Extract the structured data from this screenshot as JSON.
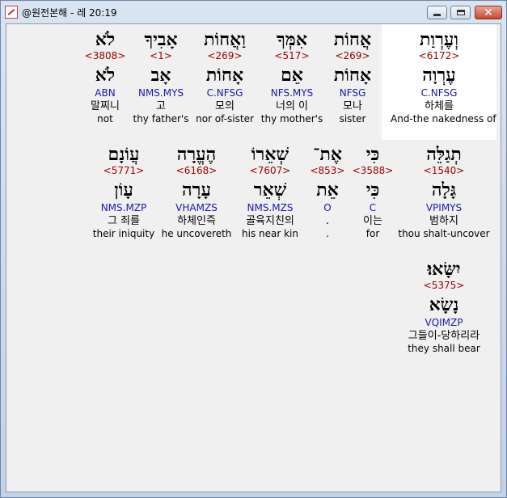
{
  "window": {
    "title": "@원전본해 - 레 20:19",
    "close_glyph": "✕"
  },
  "words": [
    {
      "hebrew": "וְעֶרְוַת",
      "strong": "<6172>",
      "root": "עֶרְוָה",
      "morph": "C.NFSG",
      "korean": "하체를",
      "english": "And-the nakedness of",
      "highlighted": true
    },
    {
      "hebrew": "אֲחוֹת",
      "strong": "<269>",
      "root": "אָחוֹת",
      "morph": "NFSG",
      "korean": "모나",
      "english": "sister"
    },
    {
      "hebrew": "אִמְּךָ",
      "strong": "<517>",
      "root": "אֵם",
      "morph": "NFS.MYS",
      "korean": "너의 이",
      "english": "thy mother's"
    },
    {
      "hebrew": "וַאֲחוֹת",
      "strong": "<269>",
      "root": "אָחוֹת",
      "morph": "C.NFSG",
      "korean": "모의",
      "english": "nor of-sister"
    },
    {
      "hebrew": "אָבִיךָ",
      "strong": "<1>",
      "root": "אָב",
      "morph": "NMS.MYS",
      "korean": "고",
      "english": "thy father's"
    },
    {
      "hebrew": "לֹא",
      "strong": "<3808>",
      "root": "לֹא",
      "morph": "ABN",
      "korean": "말찌니",
      "english": "not"
    },
    {
      "hebrew": "תְגַלֵּה",
      "strong": "<1540>",
      "root": "גָּלָה",
      "morph": "VPIMYS",
      "korean": "범하지",
      "english": "thou shalt-uncover"
    },
    {
      "hebrew": "כִּי",
      "strong": "<3588>",
      "root": "כִּי",
      "morph": "C",
      "korean": "이는",
      "english": "for"
    },
    {
      "hebrew": "אֶת־",
      "strong": "<853>",
      "root": "אֵת",
      "morph": "O",
      "korean": ".",
      "english": "."
    },
    {
      "hebrew": "שְׁאֵרוֹ",
      "strong": "<7607>",
      "root": "שְׁאֵר",
      "morph": "NMS.MZS",
      "korean": "골육지친의",
      "english": "his near kin"
    },
    {
      "hebrew": "הֶעֱרָה",
      "strong": "<6168>",
      "root": "עָרָה",
      "morph": "VHAMZS",
      "korean": "하체인즉",
      "english": "he uncovereth"
    },
    {
      "hebrew": "עֲוֹנָם",
      "strong": "<5771>",
      "root": "עָוֹן",
      "morph": "NMS.MZP",
      "korean": "그 죄를",
      "english": "their iniquity"
    },
    {
      "hebrew": "יִשָּׂאוּ׃",
      "strong": "<5375>",
      "root": "נָשָׂא",
      "morph": "VQIMZP",
      "korean": "그들이-당하리라",
      "english": "they shall bear"
    }
  ]
}
